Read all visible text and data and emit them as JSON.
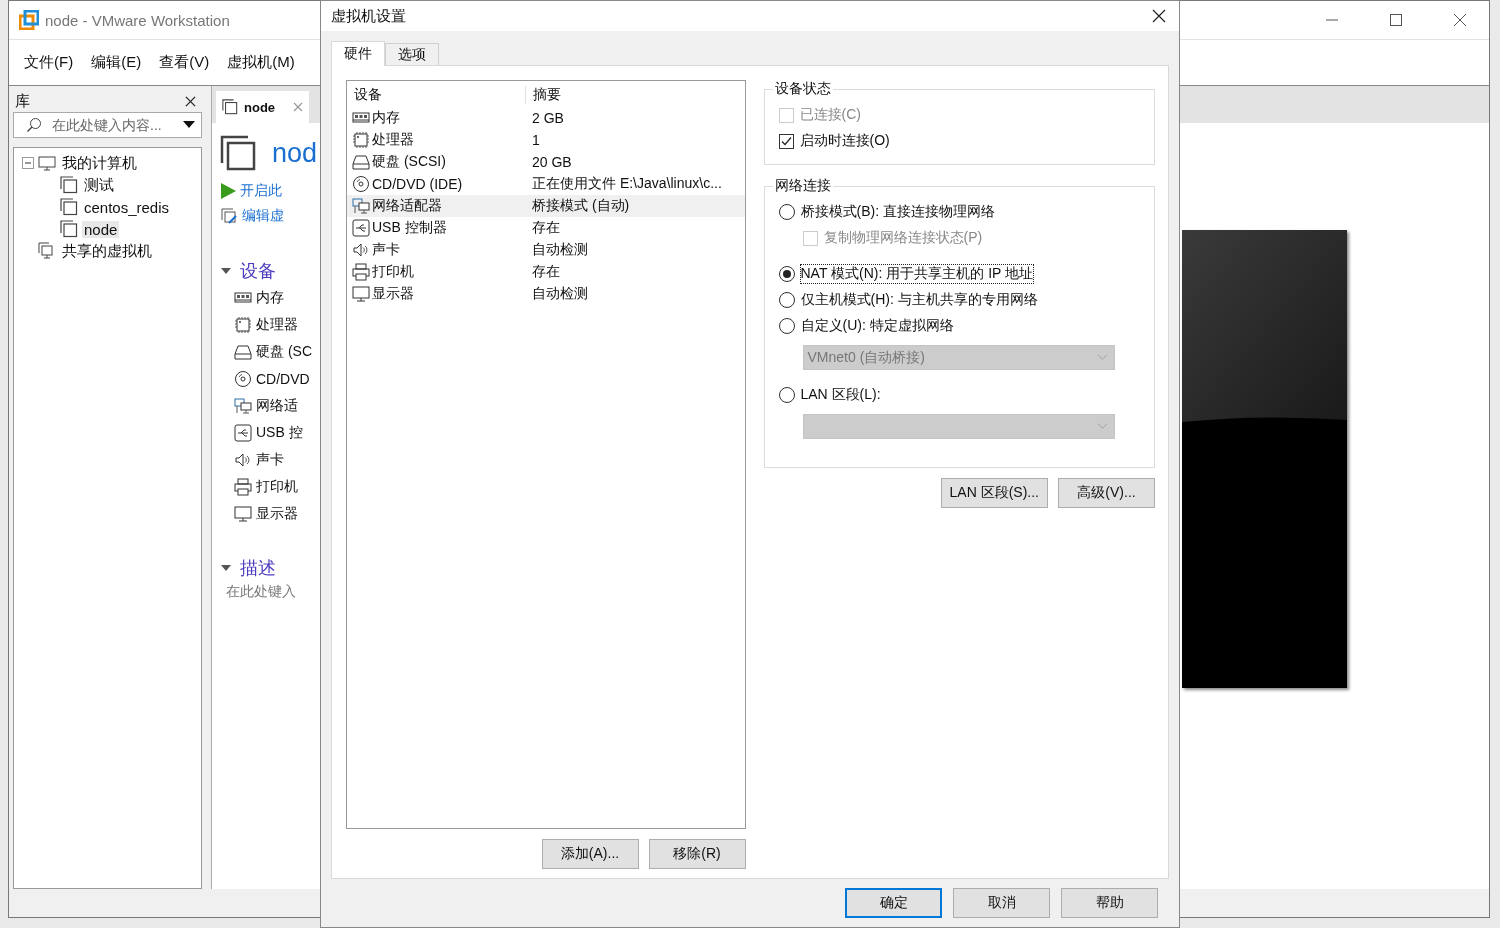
{
  "main_window": {
    "title": "node - VMware Workstation",
    "menu": [
      "文件(F)",
      "编辑(E)",
      "查看(V)",
      "虚拟机(M)"
    ],
    "library": {
      "title": "库",
      "search": {
        "placeholder": "在此处键入内容..."
      },
      "tree": [
        {
          "label": "我的计算机",
          "kind": "computer",
          "expanded": true,
          "selected": false,
          "children": [
            {
              "label": "测试",
              "kind": "vm",
              "selected": false
            },
            {
              "label": "centos_redis",
              "kind": "vm",
              "selected": false
            },
            {
              "label": "node",
              "kind": "vm",
              "selected": true
            }
          ]
        },
        {
          "label": "共享的虚拟机",
          "kind": "shared",
          "selected": false
        }
      ]
    },
    "tab": {
      "label": "node"
    },
    "vm_title": "nod",
    "actions": [
      {
        "label": "开启此",
        "kind": "play"
      },
      {
        "label": "编辑虚",
        "kind": "edit"
      }
    ],
    "devices_section": {
      "title": "设备",
      "expanded": true
    },
    "devices": [
      {
        "label": "内存",
        "kind": "memory"
      },
      {
        "label": "处理器",
        "kind": "cpu"
      },
      {
        "label": "硬盘 (SC",
        "kind": "disk"
      },
      {
        "label": "CD/DVD",
        "kind": "cd"
      },
      {
        "label": "网络适",
        "kind": "network"
      },
      {
        "label": "USB 控",
        "kind": "usb"
      },
      {
        "label": "声卡",
        "kind": "sound"
      },
      {
        "label": "打印机",
        "kind": "printer"
      },
      {
        "label": "显示器",
        "kind": "display"
      }
    ],
    "description_section": {
      "title": "描述",
      "expanded": true,
      "placeholder": "在此处键入"
    }
  },
  "dialog": {
    "title": "虚拟机设置",
    "tabs": [
      {
        "label": "硬件",
        "selected": true
      },
      {
        "label": "选项",
        "selected": false
      }
    ],
    "device_list": {
      "columns": [
        "设备",
        "摘要"
      ],
      "rows": [
        {
          "device": "内存",
          "summary": "2 GB",
          "kind": "memory",
          "selected": false
        },
        {
          "device": "处理器",
          "summary": "1",
          "kind": "cpu",
          "selected": false
        },
        {
          "device": "硬盘 (SCSI)",
          "summary": "20 GB",
          "kind": "disk",
          "selected": false
        },
        {
          "device": "CD/DVD (IDE)",
          "summary": "正在使用文件 E:\\Java\\linux\\c...",
          "kind": "cd",
          "selected": false
        },
        {
          "device": "网络适配器",
          "summary": "桥接模式 (自动)",
          "kind": "network",
          "selected": true
        },
        {
          "device": "USB 控制器",
          "summary": "存在",
          "kind": "usb",
          "selected": false
        },
        {
          "device": "声卡",
          "summary": "自动检测",
          "kind": "sound",
          "selected": false
        },
        {
          "device": "打印机",
          "summary": "存在",
          "kind": "printer",
          "selected": false
        },
        {
          "device": "显示器",
          "summary": "自动检测",
          "kind": "display",
          "selected": false
        }
      ]
    },
    "list_buttons": [
      "添加(A)...",
      "移除(R)"
    ],
    "device_status": {
      "title": "设备状态",
      "options": [
        {
          "label": "已连接(C)",
          "checked": false,
          "disabled": true
        },
        {
          "label": "启动时连接(O)",
          "checked": true,
          "disabled": false
        }
      ]
    },
    "network": {
      "title": "网络连接",
      "options": [
        {
          "kind": "radio",
          "label": "桥接模式(B): 直接连接物理网络",
          "selected": false
        },
        {
          "kind": "checkbox",
          "label": "复制物理网络连接状态(P)",
          "checked": false,
          "disabled": true
        },
        {
          "kind": "radio",
          "label": "NAT 模式(N): 用于共享主机的 IP 地址",
          "selected": true,
          "focused": true
        },
        {
          "kind": "radio",
          "label": "仅主机模式(H): 与主机共享的专用网络",
          "selected": false
        },
        {
          "kind": "radio",
          "label": "自定义(U): 特定虚拟网络",
          "selected": false
        },
        {
          "kind": "select",
          "value": "VMnet0 (自动桥接)",
          "disabled": true
        },
        {
          "kind": "radio",
          "label": "LAN 区段(L):",
          "selected": false
        },
        {
          "kind": "select",
          "disabled": true
        }
      ]
    },
    "network_buttons": [
      "LAN 区段(S)...",
      "高级(V)..."
    ],
    "footer_buttons": [
      {
        "label": "确定",
        "default": true
      },
      {
        "label": "取消",
        "default": false
      },
      {
        "label": "帮助",
        "default": false
      }
    ]
  }
}
